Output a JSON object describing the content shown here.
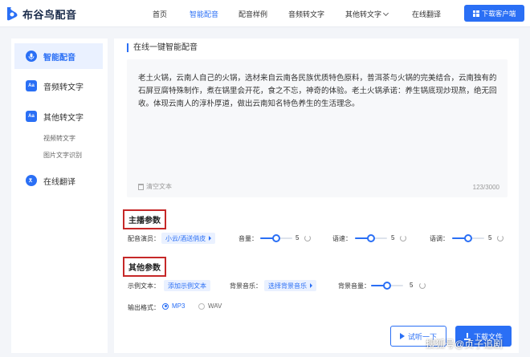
{
  "header": {
    "brand": "布谷鸟配音",
    "nav": [
      {
        "label": "首页"
      },
      {
        "label": "智能配音"
      },
      {
        "label": "配音样例"
      },
      {
        "label": "音频转文字"
      },
      {
        "label": "其他转文字"
      },
      {
        "label": "在线翻译"
      }
    ],
    "download_client": "下载客户端"
  },
  "sidebar": {
    "items": [
      {
        "label": "智能配音",
        "icon": "mic-icon"
      },
      {
        "label": "音频转文字",
        "icon": "aa-icon",
        "icon_text": "Aa"
      },
      {
        "label": "其他转文字",
        "icon": "aa-icon",
        "icon_text": "Aa"
      },
      {
        "label": "在线翻译",
        "icon": "translate-icon"
      }
    ],
    "sub_items": [
      "视频转文字",
      "图片文字识别"
    ]
  },
  "main": {
    "section_title": "在线一键智能配音",
    "text": "老土火锅，云南人自己的火锅，选材来自云南各民族优质特色原料，普洱茶与火锅的完美结合，云南独有的石屏豆腐特殊制作，煮在锅里会开花，食之不忘，神奇的体验。老土火锅承诺：养生锅底现炒现熬，绝无回收。体现云南人的淳朴厚道，做出云南知名特色养生的生活理念。",
    "clear_label": "清空文本",
    "counter": "123/3000",
    "host_params": {
      "title": "主播参数",
      "voice_label": "配音演员：",
      "voice_value": "小云/酒送俏皮",
      "volume_label": "音量：",
      "volume_value": "5",
      "volume_level": 0.5,
      "speed_label": "语速：",
      "speed_value": "5",
      "speed_level": 0.5,
      "pitch_label": "语调：",
      "pitch_value": "5",
      "pitch_level": 0.5
    },
    "other_params": {
      "title": "其他参数",
      "sample_label": "示例文本：",
      "sample_value": "添加示例文本",
      "bgm_label": "背景音乐：",
      "bgm_value": "选择背景音乐",
      "bgm_volume_label": "背景音量：",
      "bgm_volume_value": "5",
      "bgm_volume_level": 0.5,
      "format_label": "输出格式：",
      "formats": [
        {
          "label": "MP3",
          "checked": true
        },
        {
          "label": "WAV",
          "checked": false
        }
      ]
    },
    "listen_label": "试听一下",
    "download_label": "下载文件"
  },
  "watermark": "搜狐号@贞子追剧",
  "colors": {
    "accent": "#2a6ff5",
    "highlight_box": "#c62828"
  }
}
